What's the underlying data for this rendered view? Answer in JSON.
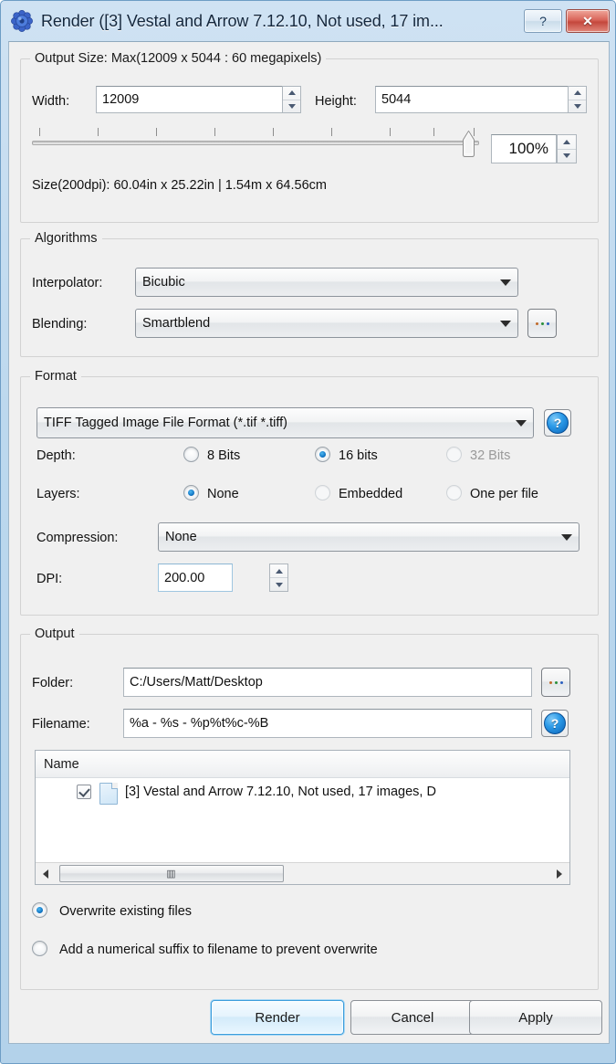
{
  "window": {
    "title": "Render ([3] Vestal and Arrow 7.12.10, Not used, 17 im...",
    "icon": "app-gear-icon",
    "help_button": "?",
    "close_button": "✕"
  },
  "output_size": {
    "group_title": "Output Size: Max(12009 x 5044 : 60 megapixels)",
    "width_label": "Width:",
    "width_value": "12009",
    "height_label": "Height:",
    "height_value": "5044",
    "zoom_value": "100%",
    "slider_percent": 100,
    "size_info": "Size(200dpi): 60.04in x 25.22in  |  1.54m x 64.56cm"
  },
  "algorithms": {
    "group_title": "Algorithms",
    "interpolator_label": "Interpolator:",
    "interpolator_value": "Bicubic",
    "blending_label": "Blending:",
    "blending_value": "Smartblend",
    "blending_more": "..."
  },
  "format": {
    "group_title": "Format",
    "file_format_value": "TIFF Tagged Image File Format (*.tif *.tiff)",
    "depth_label": "Depth:",
    "depth_options": [
      {
        "label": "8 Bits",
        "selected": false,
        "disabled": false
      },
      {
        "label": "16 bits",
        "selected": true,
        "disabled": false
      },
      {
        "label": "32 Bits",
        "selected": false,
        "disabled": true
      }
    ],
    "layers_label": "Layers:",
    "layers_options": [
      {
        "label": "None",
        "selected": true,
        "disabled": false
      },
      {
        "label": "Embedded",
        "selected": false,
        "disabled": true
      },
      {
        "label": "One per file",
        "selected": false,
        "disabled": true
      }
    ],
    "compression_label": "Compression:",
    "compression_value": "None",
    "dpi_label": "DPI:",
    "dpi_value": "200.00"
  },
  "output": {
    "group_title": "Output",
    "folder_label": "Folder:",
    "folder_value": "C:/Users/Matt/Desktop",
    "folder_browse": "...",
    "filename_label": "Filename:",
    "filename_value": "%a - %s - %p%t%c-%B",
    "list_header": "Name",
    "list_rows": [
      {
        "name": "[3] Vestal and Arrow 7.12.10, Not used, 17 images, D",
        "checked": true
      }
    ],
    "overwrite_option": "Overwrite existing files",
    "suffix_option": "Add a numerical suffix to filename to prevent overwrite",
    "overwrite_selected": true,
    "suffix_selected": false
  },
  "buttons": {
    "render": "Render",
    "cancel": "Cancel",
    "apply": "Apply"
  },
  "colors": {
    "accent": "#1277c6",
    "title_bg": "#bcd8ee",
    "client_bg": "#f0f0f0",
    "close_red": "#c4473c"
  }
}
